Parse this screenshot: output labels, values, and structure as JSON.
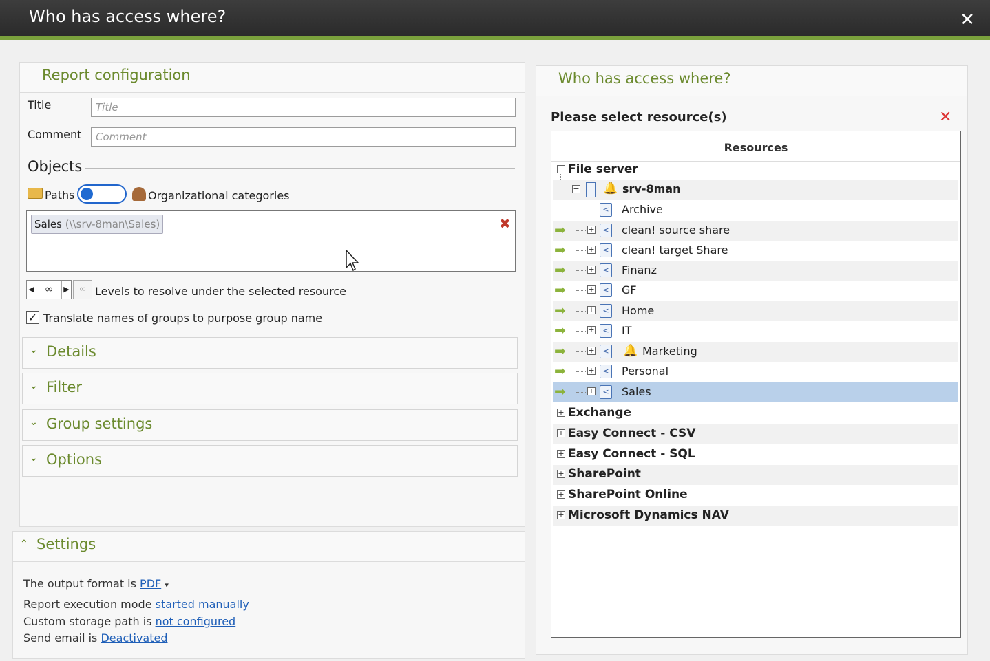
{
  "window": {
    "title": "Who has access where?",
    "close": "✕"
  },
  "left": {
    "header": "Report configuration",
    "title_label": "Title",
    "title_placeholder": "Title",
    "comment_label": "Comment",
    "comment_placeholder": "Comment",
    "objects_label": "Objects",
    "paths_label": "Paths",
    "org_label": "Organizational categories",
    "selected_object": {
      "name": "Sales",
      "path": "(\\\\srv-8man\\Sales)"
    },
    "levels": {
      "value": "∞",
      "label": "Levels to resolve under the selected resource"
    },
    "translate": {
      "checked": true,
      "label": "Translate names of groups to purpose group name"
    },
    "sections": [
      "Details",
      "Filter",
      "Group settings",
      "Options"
    ]
  },
  "settings": {
    "header": "Settings",
    "format_prefix": "The output format is",
    "format_value": "PDF",
    "mode_prefix": "Report execution mode",
    "mode_value": "started manually",
    "storage_prefix": "Custom storage path is",
    "storage_value": "not configured",
    "email_prefix": "Send email is",
    "email_value": "Deactivated"
  },
  "right": {
    "header": "Who has access where?",
    "select_label": "Please select resource(s)",
    "column": "Resources",
    "root": "File server",
    "server": "srv-8man",
    "shares": [
      "Archive",
      "clean! source share",
      "clean! target Share",
      "Finanz",
      "GF",
      "Home",
      "IT",
      "Marketing",
      "Personal",
      "Sales"
    ],
    "other_roots": [
      "Exchange",
      "Easy Connect - CSV",
      "Easy Connect - SQL",
      "SharePoint",
      "SharePoint Online",
      "Microsoft Dynamics NAV"
    ]
  }
}
